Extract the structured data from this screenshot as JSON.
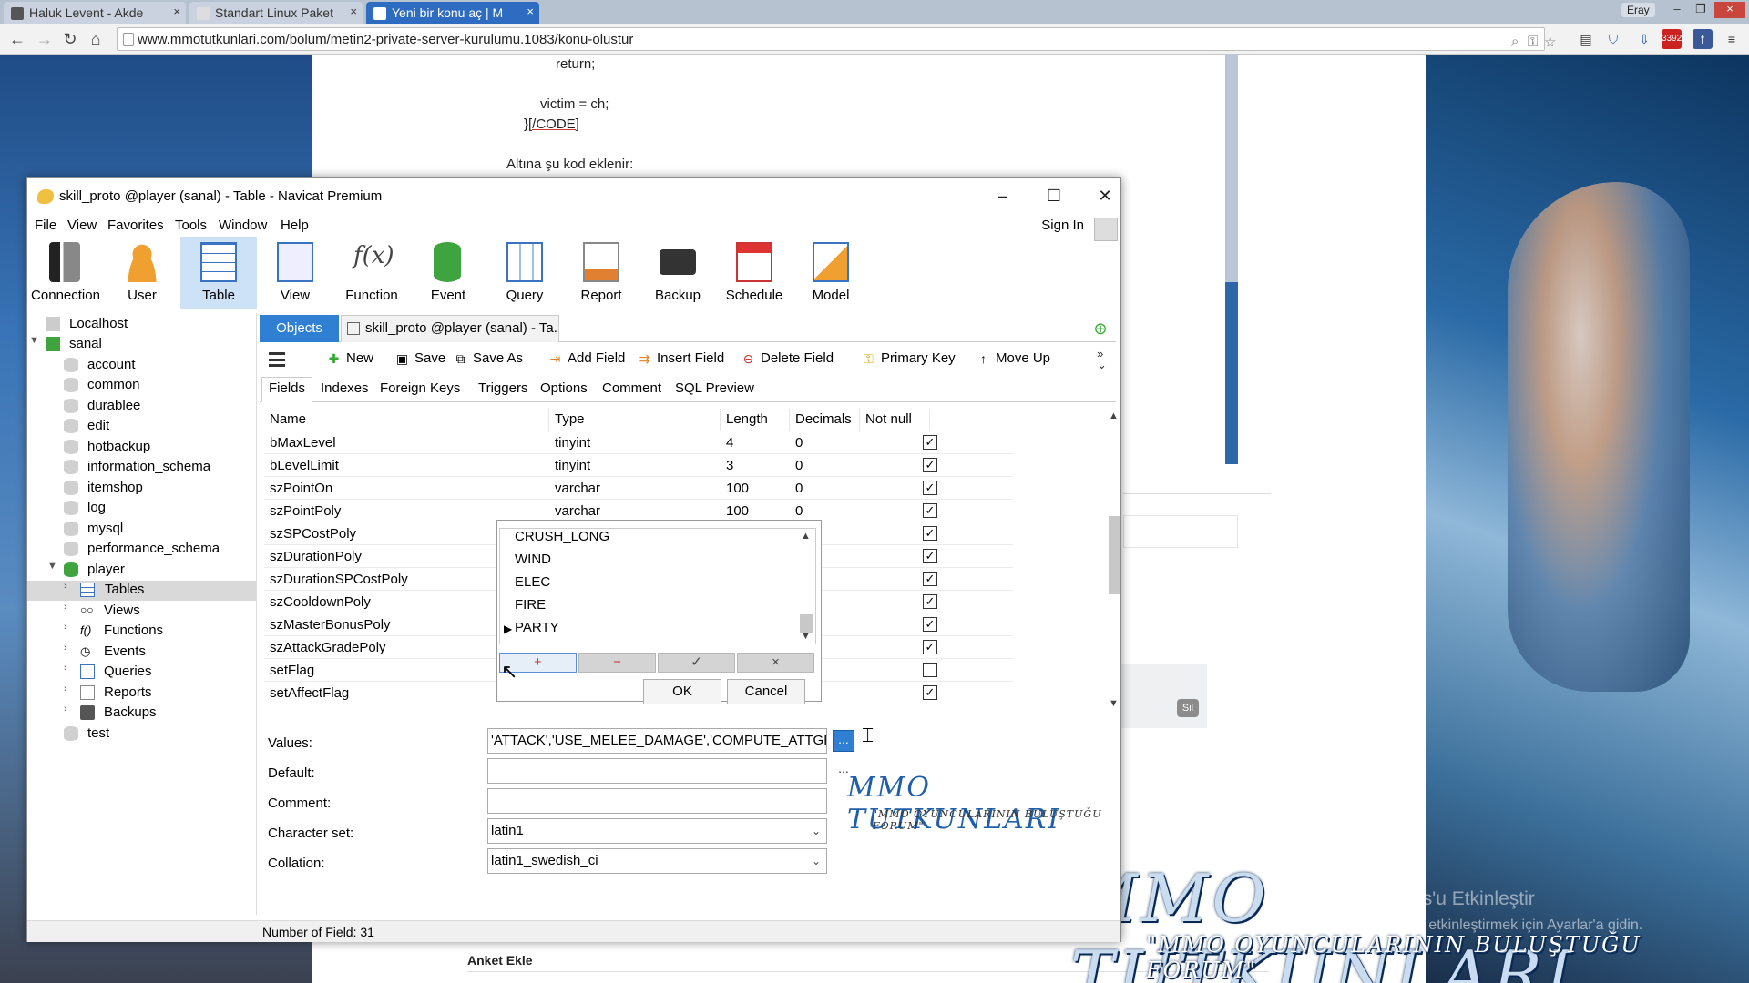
{
  "browser": {
    "tabs": [
      {
        "label": "Haluk Levent - Akde"
      },
      {
        "label": "Standart Linux Paket"
      },
      {
        "label": "Yeni bir konu aç | M"
      }
    ],
    "user": "Eray",
    "url": "www.mmotutkunlari.com/bolum/metin2-private-server-kurulumu.1083/konu-olustur",
    "badge": "3392"
  },
  "page": {
    "code_lines": [
      "return;",
      "victim = ch;",
      "}[/CODE]",
      "Altına şu kod eklenir:"
    ],
    "delete_button": "Sil",
    "poll_label": "Anket Ekle",
    "watermark": "MMO TUTKUNLARI",
    "watermark_sub": "\"MMO OYUNCULARININ BULUŞTUĞU FORUM\"",
    "windows_activation_1": "Windows'u Etkinleştir",
    "windows_activation_2": "Windows'u etkinleştirmek için Ayarlar'a gidin."
  },
  "navicat": {
    "title": "skill_proto @player (sanal) - Table - Navicat Premium",
    "menu": [
      "File",
      "View",
      "Favorites",
      "Tools",
      "Window",
      "Help"
    ],
    "sign_in": "Sign In",
    "toolbar": [
      "Connection",
      "User",
      "Table",
      "View",
      "Function",
      "Event",
      "Query",
      "Report",
      "Backup",
      "Schedule",
      "Model"
    ],
    "tree": {
      "connection": "Localhost",
      "root": "sanal",
      "databases": [
        "account",
        "common",
        "durablee",
        "edit",
        "hotbackup",
        "information_schema",
        "itemshop",
        "log",
        "mysql",
        "performance_schema"
      ],
      "player": "player",
      "player_children": [
        "Tables",
        "Views",
        "Functions",
        "Events",
        "Queries",
        "Reports",
        "Backups"
      ],
      "last": "test"
    },
    "tabs": {
      "objects": "Objects",
      "table": "skill_proto @player (sanal) - Ta..."
    },
    "field_toolbar": [
      "New",
      "Save",
      "Save As",
      "Add Field",
      "Insert Field",
      "Delete Field",
      "Primary Key",
      "Move Up"
    ],
    "subtabs": [
      "Fields",
      "Indexes",
      "Foreign Keys",
      "Triggers",
      "Options",
      "Comment",
      "SQL Preview"
    ],
    "grid": {
      "headers": [
        "Name",
        "Type",
        "Length",
        "Decimals",
        "Not null"
      ],
      "rows": [
        {
          "name": "bMaxLevel",
          "type": "tinyint",
          "length": "4",
          "decimals": "0",
          "notnull": "✓"
        },
        {
          "name": "bLevelLimit",
          "type": "tinyint",
          "length": "3",
          "decimals": "0",
          "notnull": "✓"
        },
        {
          "name": "szPointOn",
          "type": "varchar",
          "length": "100",
          "decimals": "0",
          "notnull": "✓"
        },
        {
          "name": "szPointPoly",
          "type": "varchar",
          "length": "100",
          "decimals": "0",
          "notnull": "✓"
        },
        {
          "name": "szSPCostPoly",
          "type": "",
          "length": "",
          "decimals": "",
          "notnull": "✓"
        },
        {
          "name": "szDurationPoly",
          "type": "",
          "length": "",
          "decimals": "",
          "notnull": "✓"
        },
        {
          "name": "szDurationSPCostPoly",
          "type": "",
          "length": "",
          "decimals": "",
          "notnull": "✓"
        },
        {
          "name": "szCooldownPoly",
          "type": "",
          "length": "",
          "decimals": "",
          "notnull": "✓"
        },
        {
          "name": "szMasterBonusPoly",
          "type": "",
          "length": "",
          "decimals": "",
          "notnull": "✓"
        },
        {
          "name": "szAttackGradePoly",
          "type": "",
          "length": "",
          "decimals": "",
          "notnull": "✓"
        },
        {
          "name": "setFlag",
          "type": "",
          "length": "",
          "decimals": "",
          "notnull": ""
        },
        {
          "name": "setAffectFlag",
          "type": "",
          "length": "",
          "decimals": "",
          "notnull": "✓"
        }
      ]
    },
    "popup": {
      "items": [
        "CRUSH_LONG",
        "WIND",
        "ELEC",
        "FIRE",
        "PARTY"
      ],
      "buttons": [
        "+",
        "−",
        "✓",
        "×"
      ],
      "ok": "OK",
      "cancel": "Cancel"
    },
    "props": {
      "values_label": "Values:",
      "values": "'ATTACK','USE_MELEE_DAMAGE','COMPUTE_ATTGRADE",
      "default_label": "Default:",
      "comment_label": "Comment:",
      "charset_label": "Character set:",
      "charset": "latin1",
      "collation_label": "Collation:",
      "collation": "latin1_swedish_ci",
      "ellipsis": "..."
    },
    "status": "Number of Field: 31",
    "watermark": "MMO TUTKUNLARI",
    "watermark_sub": "\"MMO OYUNCULARININ BULUŞTUĞU FORUM\""
  }
}
